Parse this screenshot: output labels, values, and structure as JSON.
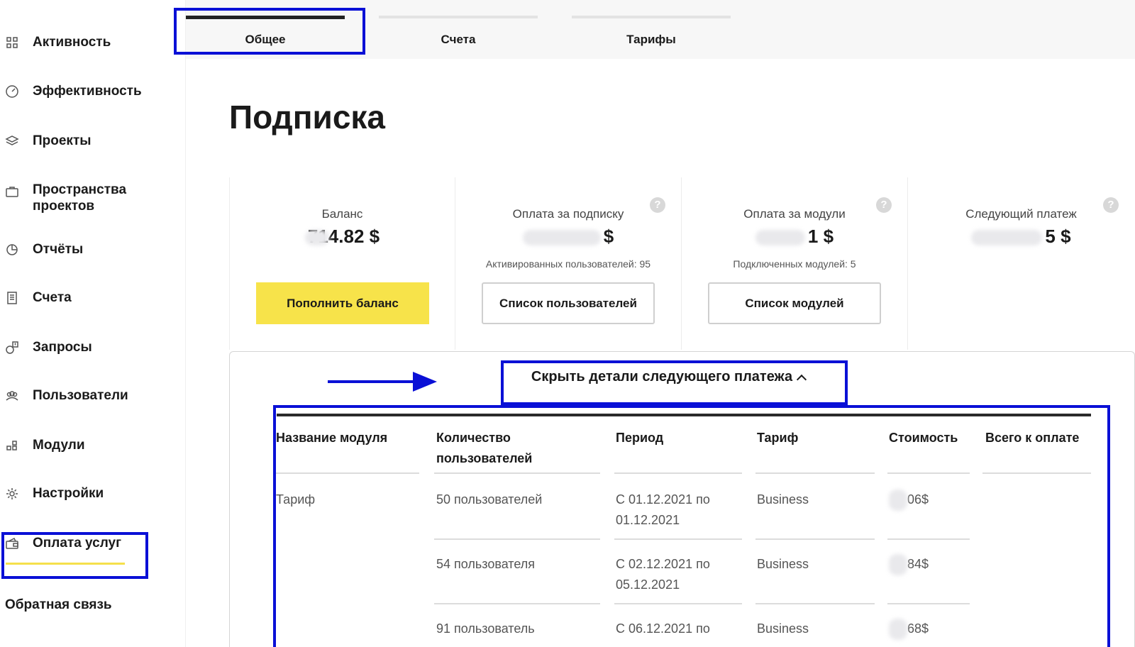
{
  "sidebar": {
    "items": [
      {
        "label": "Активность",
        "icon": "grid-icon"
      },
      {
        "label": "Эффективность",
        "icon": "speedometer-icon"
      },
      {
        "label": "Проекты",
        "icon": "layers-icon"
      },
      {
        "label": "Пространства проектов",
        "icon": "briefcase-icon"
      },
      {
        "label": "Отчёты",
        "icon": "pie-chart-icon"
      },
      {
        "label": "Счета",
        "icon": "receipt-icon"
      },
      {
        "label": "Запросы",
        "icon": "request-icon"
      },
      {
        "label": "Пользователи",
        "icon": "users-icon"
      },
      {
        "label": "Модули",
        "icon": "modules-icon"
      },
      {
        "label": "Настройки",
        "icon": "gear-icon"
      },
      {
        "label": "Оплата услуг",
        "icon": "wallet-icon",
        "active": true
      }
    ],
    "feedback": "Обратная связь"
  },
  "tabs": [
    {
      "label": "Общее",
      "active": true
    },
    {
      "label": "Счета",
      "active": false
    },
    {
      "label": "Тарифы",
      "active": false
    }
  ],
  "page_title": "Подписка",
  "cards": {
    "balance": {
      "title": "Баланс",
      "value_suffix": "714.82 $",
      "button": "Пополнить баланс"
    },
    "subscription": {
      "title": "Оплата за подписку",
      "value_suffix": "$",
      "sub": "Активированных пользователей: 95",
      "button": "Список пользователей"
    },
    "modules": {
      "title": "Оплата за модули",
      "value_suffix": "1 $",
      "sub": "Подключенных модулей: 5",
      "button": "Список модулей"
    },
    "next": {
      "title": "Следующий платеж",
      "value_suffix": "5 $"
    }
  },
  "details": {
    "toggle_label": "Скрыть детали следующего платежа",
    "columns": [
      "Название модуля",
      "Количество пользователей",
      "Период",
      "Тариф",
      "Стоимость",
      "Всего к оплате"
    ],
    "module_name": "Тариф",
    "rows": [
      {
        "users": "50 пользователей",
        "period": "С 01.12.2021 по 01.12.2021",
        "plan": "Business",
        "cost": "06$"
      },
      {
        "users": "54 пользователя",
        "period": "С 02.12.2021 по 05.12.2021",
        "plan": "Business",
        "cost": "84$"
      },
      {
        "users": "91 пользователь",
        "period": "С 06.12.2021 по",
        "plan": "Business",
        "cost": "68$"
      }
    ]
  },
  "colors": {
    "accent_yellow": "#f7e34a",
    "highlight_blue": "#0a10d6"
  }
}
